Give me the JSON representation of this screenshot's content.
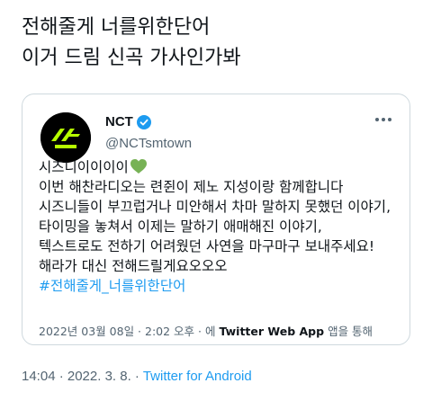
{
  "tweet": {
    "lines": [
      "전해줄게 너를위한단어",
      "이거 드림 신곡 가사인가봐"
    ]
  },
  "quote": {
    "author_name": "NCT",
    "author_handle": "@NCTsmtown",
    "avatar_alt": "NCT logo",
    "line1": "시즈니이이이이",
    "line2": "이번 해찬라디오는 련쥔이 제노 지성이랑 함께합니다",
    "line3": "시즈니들이 부끄럽거나 미안해서 차마 말하지 못했던 이야기,",
    "line4": "타이밍을 놓쳐서 이제는 말하기 애매해진 이야기,",
    "line5": "텍스트로도 전하기 어려웠던 사연을 마구마구 보내주세요!",
    "line6": "해라가 대신 전해드릴게요오오오",
    "hashtag": "#전해줄게_너를위한단어",
    "meta_date": "2022년 03월 08일 · 2:02 오후 · 에",
    "meta_source": "Twitter Web App",
    "meta_suffix": "앱을 통해",
    "colors": {
      "heart": "#77b255",
      "link": "#1d9bf0",
      "verified": "#1d9bf0"
    }
  },
  "footer": {
    "time": "14:04 · 2022. 3. 8. ·",
    "source": "Twitter for Android"
  }
}
